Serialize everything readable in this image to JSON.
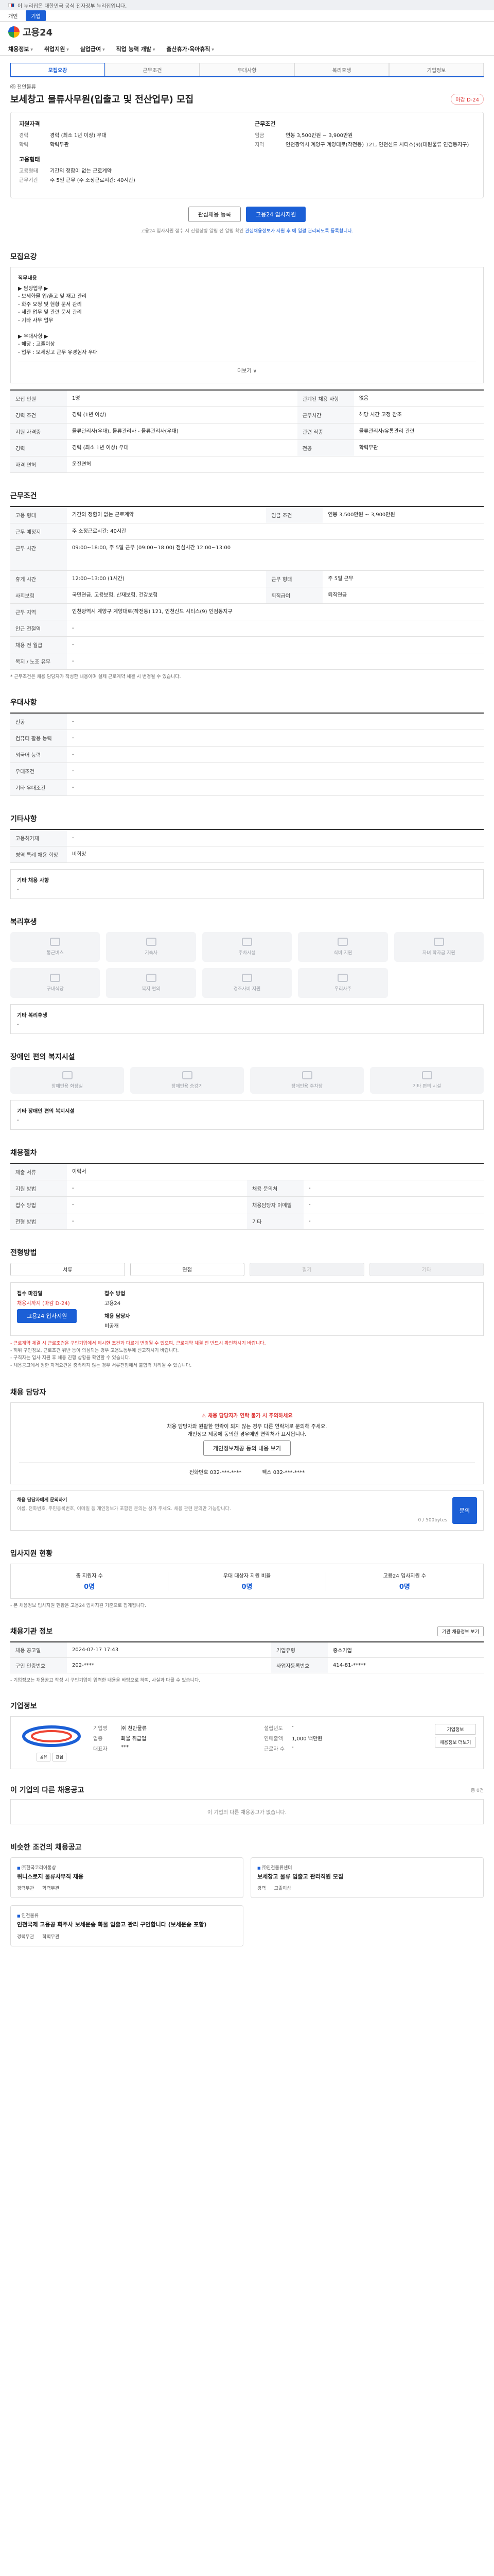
{
  "gov_banner": "이 누리집은 대한민국 공식 전자정부 누리집입니다.",
  "mode": {
    "left": "개인",
    "right": "기업"
  },
  "logo": "고용24",
  "gnb": [
    "채용정보",
    "취업지원",
    "실업급여",
    "직업 능력 개발",
    "출산휴가·육아휴직"
  ],
  "tabs": [
    "모집요강",
    "근무조건",
    "우대사항",
    "복리후생",
    "기업정보"
  ],
  "job": {
    "company": "㈜ 천안물류",
    "title": "보세창고 물류사무원(입출고 및 전산업무) 모집",
    "dday": "마감 D-24"
  },
  "summary": {
    "left": [
      {
        "h": "지원자격",
        "rows": [
          [
            "경력",
            "경력 (최소 1년 이상) 우대"
          ],
          [
            "학력",
            "학력무관"
          ]
        ]
      },
      {
        "h": "고용형태",
        "rows": [
          [
            "고용형태",
            "기간의 정함이 없는 근로계약"
          ],
          [
            "근무기간",
            "주 5일 근무 (주 소정근로시간: 40시간)"
          ]
        ]
      }
    ],
    "right": [
      {
        "h": "근무조건",
        "rows": [
          [
            "임금",
            "연봉 3,500만원 ~ 3,900만원"
          ],
          [
            "지역",
            "인천광역시 계양구 계양대로(작전동) 121, 인천신드 시티스(9)(대원물류 인검동지구)"
          ]
        ]
      }
    ]
  },
  "buttons": {
    "interest": "관심채용 등록",
    "apply": "고용24 입사지원"
  },
  "notice_center": "고용24 입사지원 접수 시 진행상황 알림 전 알림 확인 ",
  "notice_center_link": "관심채용정보가 지원 후 에 일괄 관리되도록 등록합니다.",
  "recruit": {
    "heading": "모집요강",
    "duty_title": "직무내용",
    "duty_lines": [
      "▶ 담당업무 ▶",
      "- 보세화물 입/출고 및 재고 관리",
      "- 화주 요청 및 현황 문서 관리",
      "- 세관 업무 및 관련 문서 관리",
      "- 기타 사무 업무",
      "",
      "▶ 우대사항 ▶",
      "- 해당 : 고졸이상",
      "- 업무 : 보세창고 근무 유경험자 우대"
    ],
    "more": "더보기 ∨",
    "rows": [
      [
        "모집 인원",
        "1명",
        "관계된 채용 사항",
        "없음"
      ],
      [
        "경력 조건",
        "경력 (1년 이상)",
        "근무시간",
        "해당 시간 고정 참조"
      ],
      [
        "지원 자격증",
        "물류관리사(우대), 물류관리사 - 물류관리사(우대)",
        "관련 직종",
        "물류관리사/유통관리 관련"
      ],
      [
        "경력",
        "경력 (최소 1년 이상) 우대",
        "전공",
        "학력무관"
      ],
      [
        "자격 면허",
        "운전면허",
        "",
        ""
      ]
    ]
  },
  "work": {
    "heading": "근무조건",
    "rows": [
      [
        "고용 형태",
        "기간의 정함이 없는 근로계약",
        "임금 조건",
        "연봉 3,500만원 ~ 3,900만원"
      ],
      [
        "근무 예정지",
        "주 소정근로시간: 40시간",
        "",
        ""
      ],
      [
        "근무 시간",
        "09:00~18:00, 주 5일 근무 (09:00~18:00) 점심시간 12:00~13:00",
        "",
        ""
      ],
      [
        "휴게 시간",
        "12:00~13:00 (1시간)",
        "근무 형태",
        "주 5일 근무"
      ],
      [
        "사회보험",
        "국민연금, 고용보험, 산재보험, 건강보험",
        "퇴직급여",
        "퇴직연금"
      ],
      [
        "근무 지역",
        "인천광역시 계양구 계양대로(작전동) 121, 인천신드 시티스(9) 인검동지구",
        "",
        ""
      ],
      [
        "인근 전철역",
        "-",
        "",
        ""
      ],
      [
        "채용 전 월급",
        "-",
        "",
        ""
      ],
      [
        "복지 / 노조 유무",
        "-",
        "",
        ""
      ]
    ],
    "note": "* 근무조건은 채용 담당자가 작성한 내용이며 실제 근로계약 체결 시 변경될 수 있습니다."
  },
  "pref": {
    "heading": "우대사항",
    "rows": [
      [
        "전공",
        "-"
      ],
      [
        "컴퓨터 활용 능력",
        "-"
      ],
      [
        "외국어 능력",
        "-"
      ],
      [
        "우대조건",
        "-"
      ],
      [
        "기타 우대조건",
        "-"
      ]
    ]
  },
  "etc": {
    "heading": "기타사항",
    "rows": [
      [
        "고용허가제",
        "-"
      ],
      [
        "병역 특례 채용 희망",
        "비희망"
      ]
    ],
    "sub_title": "기타 채용 사항",
    "sub_body": "-"
  },
  "welfare": {
    "heading": "복리후생",
    "icons1": [
      "통근버스",
      "기숙사",
      "주차시설",
      "식비 지원",
      "자녀 학자금 지원"
    ],
    "icons2": [
      "구내식당",
      "복지·편의",
      "경조사비 지원",
      "우리사주"
    ],
    "sub_title": "기타 복리후생",
    "sub_body": "-"
  },
  "disabled": {
    "heading": "장애인 편의 복지시설",
    "icons": [
      "장애인용 화장실",
      "장애인용 승강기",
      "장애인용 주차장",
      "기타 편의 시설"
    ],
    "sub_title": "기타 장애인 편의 복지시설",
    "sub_body": "-"
  },
  "process": {
    "heading": "채용절차",
    "rows": [
      [
        "제출 서류",
        "이력서",
        "",
        ""
      ],
      [
        "지원 방법",
        "-",
        "채용 문의처",
        "-"
      ],
      [
        "접수 방법",
        "-",
        "채용담당자 이메일",
        "-"
      ],
      [
        "전형 방법",
        "-",
        "기타",
        "-"
      ]
    ]
  },
  "apply": {
    "heading": "전형방법",
    "methods": [
      {
        "t": "서류",
        "on": true
      },
      {
        "t": "면접",
        "on": true
      },
      {
        "t": "필기",
        "on": false
      },
      {
        "t": "기타",
        "on": false
      }
    ],
    "deadline_title": "접수 마감일",
    "deadline_value": "채용시까지 (마감 D-24)",
    "apply_btn": "고용24 입사지원",
    "c2_title": "접수 방법",
    "c2_value": "고용24",
    "c3_title": "채용 담당자",
    "c3_value": "비공개",
    "bullets": [
      "- 근로계약 체결 시 근로조건은 구인기업에서 제시한 조건과 다르게 변경될 수 있으며, 근로계약 체결 전 반드시 확인하시기 바랍니다.",
      "- 허위 구인정보, 근로조건 위반 등이 의심되는 경우 고용노동부에 신고하시기 바랍니다.",
      "- 구직자는 입사 지원 후 채용 진행 상황을 확인할 수 있습니다.",
      "- 채용공고에서 정한 자격요건을 충족하지 않는 경우 서류전형에서 불합격 처리될 수 있습니다."
    ]
  },
  "manager": {
    "heading": "채용 담당자",
    "warn": "채용 담당자가 연락 불가 시 주의하세요",
    "desc1": "채용 담당자와 원활한 연락이 되지 않는 경우 다른 연락처로 문의해 주세요.",
    "desc2": "개인정보 제공에 동의한 경우에만 연락처가 표시됩니다.",
    "btn": "개인정보제공 동의 내용 보기",
    "phone_label": "전화번호",
    "phone": "032-***-****",
    "fax_label": "팩스",
    "fax": "032-***-****",
    "q_title": "채용 담당자에게 문의하기",
    "q_placeholder": "이름, 전화번호, 주민등록번호, 이메일 등 개인정보가 포함된 문의는 삼가 주세요. 채용 관련 문의만 가능합니다.",
    "q_count": "0 / 500bytes",
    "q_btn": "문의"
  },
  "stats": {
    "heading": "입사지원 현황",
    "items": [
      {
        "k": "총 지원자 수",
        "v": "0명"
      },
      {
        "k": "우대 대상자 지원 비율",
        "v": "0명"
      },
      {
        "k": "고용24 입사지원 수",
        "v": "0명"
      }
    ],
    "note": "- 본 채용정보 입사지원 현황은 고용24 입사지원 기준으로 집계됩니다."
  },
  "info": {
    "heading": "채용기관 정보",
    "btn": "기관 채용정보 보기",
    "rows": [
      [
        "채용 공고일",
        "2024-07-17 17:43",
        "기업유형",
        "중소기업"
      ],
      [
        "구인 인증번호",
        "202-****",
        "사업자등록번호",
        "414-81-*****"
      ]
    ],
    "note": "- 기업정보는 채용공고 작성 시 구인기업이 입력한 내용을 바탕으로 하며, 사실과 다를 수 있습니다."
  },
  "corp": {
    "heading": "기업정보",
    "btns": [
      "공유",
      "관심"
    ],
    "rows1": [
      [
        "기업명",
        "㈜ 천안물류"
      ],
      [
        "업종",
        "화물 취급업"
      ],
      [
        "대표자",
        "***"
      ]
    ],
    "rows2": [
      [
        "설립년도",
        "-"
      ],
      [
        "연매출액",
        "1,000 백만원"
      ],
      [
        "근로자 수",
        "-"
      ]
    ],
    "side": [
      "기업정보",
      "채용정보 더보기"
    ]
  },
  "other": {
    "heading": "이 기업의 다른 채용공고",
    "sm": "총 0건",
    "empty": "이 기업의 다른 채용공고가 없습니다."
  },
  "similar": {
    "heading": "비슷한 조건의 채용공고",
    "cards": [
      {
        "co": "㈜한국코리아통상",
        "title": "위니스로지 물류사무직 채용",
        "m1": "경력무관",
        "m2": "학력무관"
      },
      {
        "co": "㈜인천물류센터",
        "title": "보세창고 물류 입출고 관리직원 모집",
        "m1": "경력",
        "m2": "고졸이상"
      },
      {
        "co": "인천물류",
        "title": "인천국제 고용공 화주사 보세운송 화물 입출고 관리 구인합니다 (보세운송 포함)",
        "m1": "경력무관",
        "m2": "학력무관"
      }
    ]
  }
}
